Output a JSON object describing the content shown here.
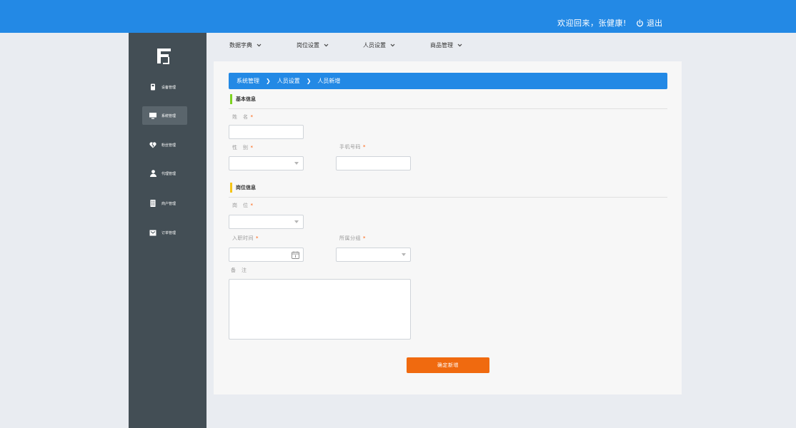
{
  "header": {
    "welcome_text": "欢迎回来，张健康!",
    "logout_label": "退出",
    "logout_icon": "power-icon"
  },
  "colors": {
    "primary": "#2389e5",
    "sidebar_bg": "#434e55",
    "sidebar_active": "#5a656c",
    "accent_green": "#7ed321",
    "accent_yellow": "#f5c518",
    "required": "#ff5a00",
    "submit": "#f06a0f"
  },
  "sidebar": {
    "logo_icon": "app-logo",
    "items": [
      {
        "label": "设备管理",
        "icon": "device-icon",
        "active": false
      },
      {
        "label": "系统管理",
        "icon": "monitor-icon",
        "active": true
      },
      {
        "label": "粉丝管理",
        "icon": "heart-broken-icon",
        "active": false
      },
      {
        "label": "代理管理",
        "icon": "user-icon",
        "active": false
      },
      {
        "label": "商户管理",
        "icon": "building-icon",
        "active": false
      },
      {
        "label": "订单管理",
        "icon": "order-icon",
        "active": false
      }
    ]
  },
  "tabs": [
    {
      "label": "数据字典"
    },
    {
      "label": "岗位设置"
    },
    {
      "label": "人员设置"
    },
    {
      "label": "商品管理"
    }
  ],
  "breadcrumb": {
    "items": [
      "系统管理",
      "人员设置",
      "人员新增"
    ],
    "separator": "❯"
  },
  "sections": {
    "basic": {
      "title": "基本信息"
    },
    "position": {
      "title": "岗位信息"
    }
  },
  "form": {
    "name": {
      "label": "姓　名",
      "required": "*",
      "value": ""
    },
    "gender": {
      "label": "性　别",
      "required": "*",
      "value": ""
    },
    "phone": {
      "label": "手机号码",
      "required": "*",
      "value": ""
    },
    "post": {
      "label": "岗　位",
      "required": "*",
      "value": ""
    },
    "hire_date": {
      "label": "入职时间",
      "required": "*",
      "value": ""
    },
    "group": {
      "label": "所属分组",
      "required": "*",
      "value": ""
    },
    "remark": {
      "label": "备　注",
      "value": ""
    }
  },
  "submit_label": "确定新增"
}
